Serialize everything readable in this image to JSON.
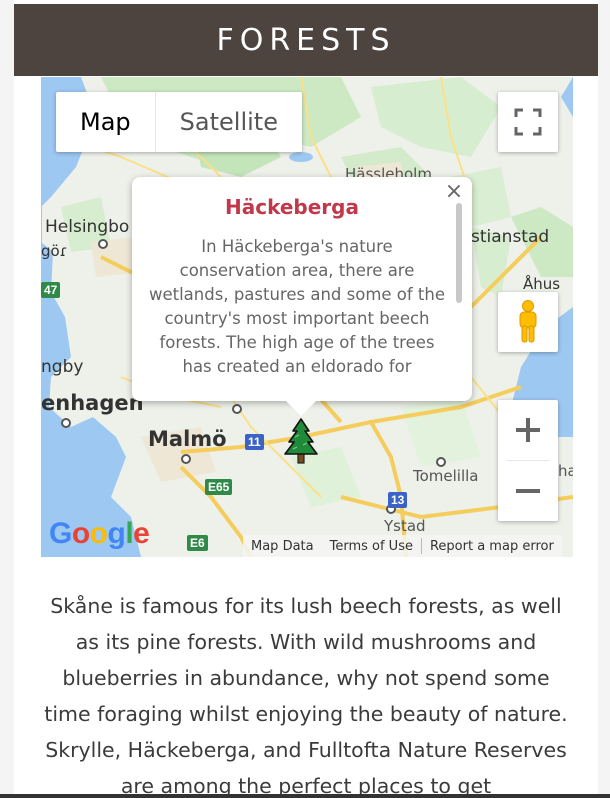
{
  "header": {
    "title": "FORESTS"
  },
  "map": {
    "type_control": {
      "map_label": "Map",
      "satellite_label": "Satellite"
    },
    "zoom": {
      "in_label": "+",
      "out_label": "−"
    },
    "info_window": {
      "close_label": "×",
      "title": "Häckeberga",
      "body": "In Häckeberga's nature conservation area, there are wetlands, pastures and some of the country's most important beech forests. The high age of the trees has created an eldorado for"
    },
    "place_labels": {
      "hassleholm": "Hässleholm",
      "helsingborg": "Helsingbo",
      "kristianstad": "stianstad",
      "ahus": "Åhus",
      "angelholm": "göɾ",
      "landskrona": "ngby",
      "copenhagen": "enhagen",
      "malmo": "Malmö",
      "tomelilla": "Tomelilla",
      "ystad": "Ystad",
      "edge_na": "ha"
    },
    "road_shields": {
      "r11": "11",
      "r13": "13",
      "e65": "E65",
      "e6": "E6",
      "r47": "47"
    },
    "logo": {
      "g1": "G",
      "o1": "o",
      "o2": "o",
      "g2": "g",
      "l": "l",
      "e": "e"
    },
    "attribution": {
      "map_data": "Map Data",
      "terms": "Terms of Use",
      "report": "Report a map error"
    }
  },
  "description": "Skåne is famous for its lush beech forests, as well as its pine forests. With wild mushrooms and blueberries in abundance, why not spend some time foraging whilst enjoying the beauty of nature. Skrylle, Häckeberga, and Fulltofta Nature Reserves are among the perfect places to get",
  "colors": {
    "header_bg": "#4d4440",
    "title_accent": "#c0394b",
    "water": "#9dc8f2",
    "land": "#eef0ea",
    "forest": "#cde9c4",
    "road_yellow": "#fbe08a"
  }
}
